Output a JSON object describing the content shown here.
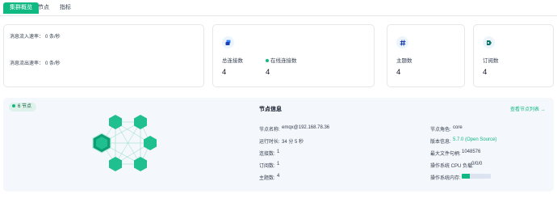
{
  "tabs": [
    {
      "label": "集群概览",
      "active": true
    },
    {
      "label": "节点",
      "active": false
    },
    {
      "label": "指标",
      "active": false
    }
  ],
  "rates": {
    "in_label": "消息流入速率：",
    "in_value": "0 条/秒",
    "out_label": "消息流出速率：",
    "out_value": "0 条/秒"
  },
  "stats": {
    "connections_label": "总连接数",
    "connections_value": "4",
    "online_label": "在线连接数",
    "online_value": "4",
    "topics_label": "主题数",
    "topics_value": "4",
    "subscriptions_label": "订阅数",
    "subscriptions_value": "4"
  },
  "nodes": {
    "badge": "6 节点",
    "title": "节点信息",
    "view_link": "查看节点列表 →",
    "fields": {
      "name_label": "节点名称:",
      "name_value": "emqx@192.168.78.36",
      "uptime_label": "运行时长:",
      "uptime_value": "34 分 5 秒",
      "conn_label": "连接数:",
      "conn_value": "1",
      "subs_label": "订阅数:",
      "subs_value": "1",
      "topics_label": "主题数:",
      "topics_value": "4",
      "role_label": "节点角色:",
      "role_value": "core",
      "version_label": "版本信息:",
      "version_value": "5.7.0 (Open Source)",
      "fd_label": "最大文件句柄:",
      "fd_value": "1048576",
      "cpu_label": "操作系统 CPU 负载:",
      "cpu_value": "0/0/0",
      "mem_label": "操作系统内存:",
      "mem_fraction": 0.28
    }
  },
  "colors": {
    "accent": "#10b981",
    "hex_fill": "#1fbf8f",
    "hex_active": "#0d9e76",
    "panel_bg": "#f4f7fb"
  }
}
